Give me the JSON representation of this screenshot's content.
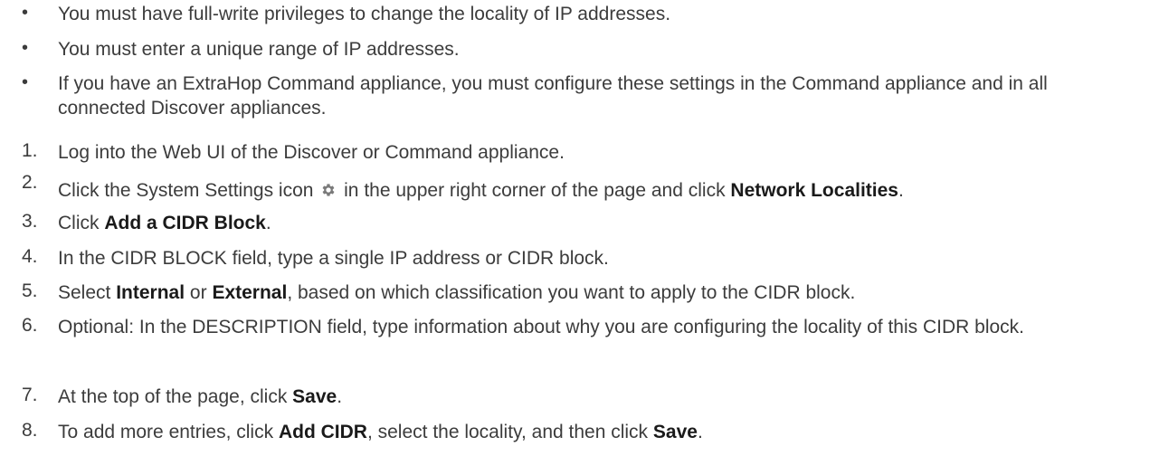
{
  "prerequisites": [
    "You must have full-write privileges to change the locality of IP addresses.",
    "You must enter a unique range of IP addresses.",
    "If you have an ExtraHop Command appliance, you must configure these settings in the Command appliance and in all connected Discover appliances."
  ],
  "bullet_char": "•",
  "steps": {
    "s1": {
      "num": "1.",
      "text": "Log into the Web UI of the Discover or Command appliance."
    },
    "s2": {
      "num": "2.",
      "pre": "Click the System Settings icon",
      "mid": "in the upper right corner of the page and click",
      "bold": "Network Localities",
      "post": "."
    },
    "s3": {
      "num": "3.",
      "pre": "Click",
      "bold": "Add a CIDR Block",
      "post": "."
    },
    "s4": {
      "num": "4.",
      "text": "In the CIDR BLOCK field, type a single IP address or CIDR block."
    },
    "s5": {
      "num": "5.",
      "pre": "Select",
      "bold1": "Internal",
      "mid": "or",
      "bold2": "External",
      "post": ", based on which classification you want to apply to the CIDR block."
    },
    "s6": {
      "num": "6.",
      "text": "Optional: In the DESCRIPTION field, type information about why you are configuring the locality of this CIDR block."
    },
    "s7": {
      "num": "7.",
      "pre": "At the top of the page, click",
      "bold": "Save",
      "post": "."
    },
    "s8": {
      "num": "8.",
      "pre": "To add more entries, click",
      "bold1": "Add CIDR",
      "mid": ", select the locality, and then click",
      "bold2": "Save",
      "post": "."
    }
  },
  "icons": {
    "settings": "gear-icon"
  },
  "colors": {
    "text": "#3c3c3c",
    "bold": "#1a1a1a",
    "icon": "#7a7a7a"
  }
}
